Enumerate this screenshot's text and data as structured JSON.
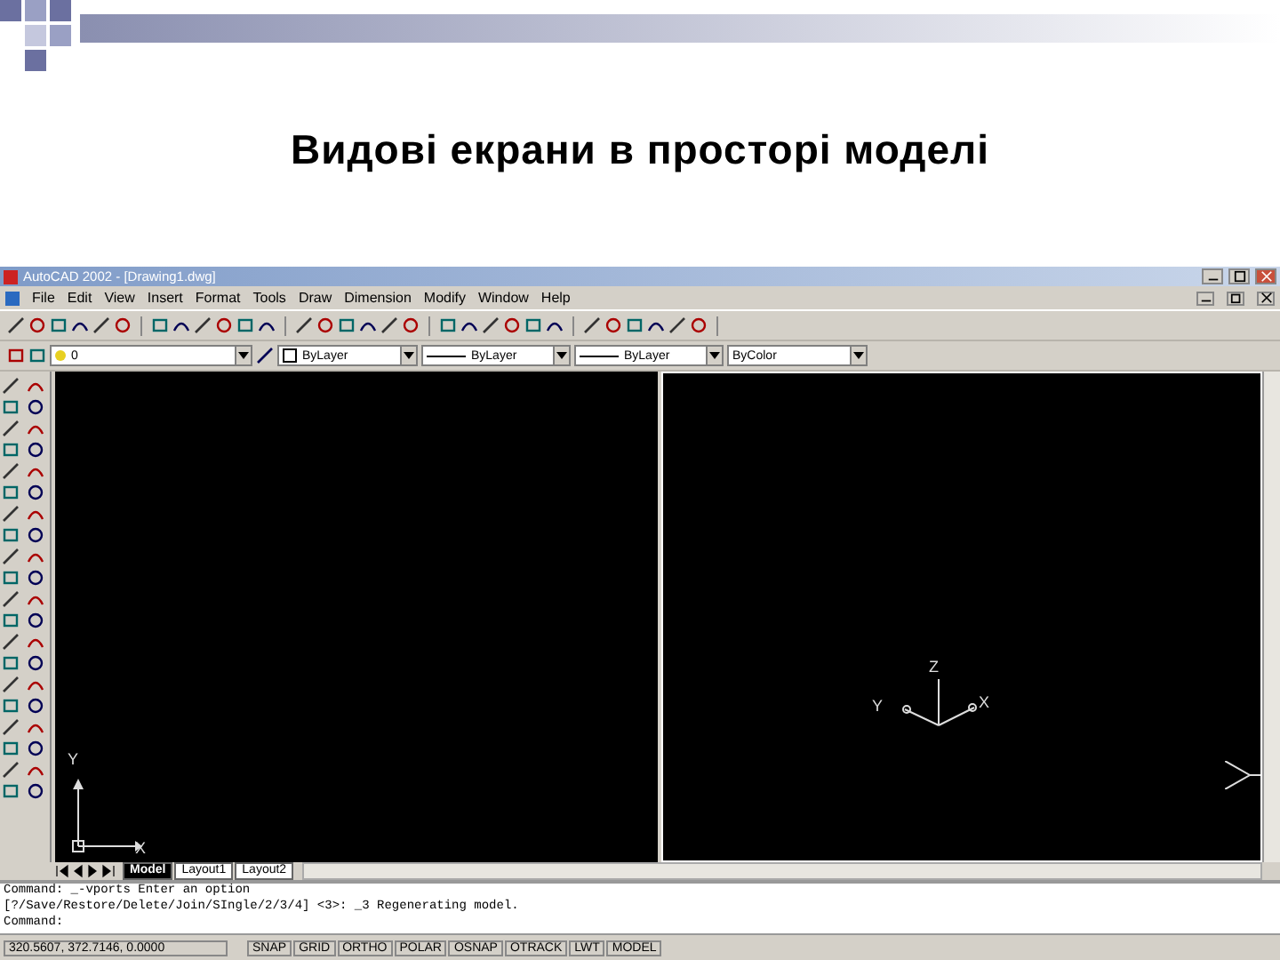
{
  "slide": {
    "title": "Видові екрани в просторі  моделі"
  },
  "window": {
    "title": "AutoCAD 2002 - [Drawing1.dwg]"
  },
  "menu": [
    "File",
    "Edit",
    "View",
    "Insert",
    "Format",
    "Tools",
    "Draw",
    "Dimension",
    "Modify",
    "Window",
    "Help"
  ],
  "properties_toolbar": {
    "layer": "0",
    "color_control": "ByLayer",
    "linetype": "ByLayer",
    "lineweight": "ByLayer",
    "plot_style": "ByColor"
  },
  "viewports": [
    {
      "selected": false,
      "ucs": {
        "kind": "planar",
        "labels": [
          "X",
          "Y"
        ]
      }
    },
    {
      "selected": true,
      "ucs": {
        "kind": "isometric",
        "labels": [
          "X",
          "Y",
          "Z"
        ]
      }
    }
  ],
  "layout_tabs": [
    {
      "label": "Model",
      "selected": true
    },
    {
      "label": "Layout1",
      "selected": false
    },
    {
      "label": "Layout2",
      "selected": false
    }
  ],
  "command_lines": [
    "Command:  _-vports Enter an option",
    "[?/Save/Restore/Delete/Join/SIngle/2/3/4] <3>: _3  Regenerating model.",
    "Command:"
  ],
  "status_bar": {
    "coordinates": "320.5607, 372.7146, 0.0000",
    "buttons": [
      "SNAP",
      "GRID",
      "ORTHO",
      "POLAR",
      "OSNAP",
      "OTRACK",
      "LWT",
      "MODEL"
    ]
  }
}
